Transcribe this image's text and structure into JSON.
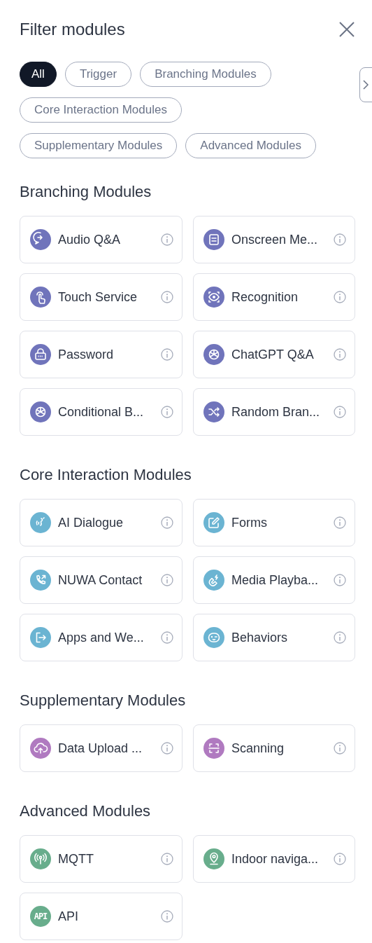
{
  "title": "Filter modules",
  "filters": [
    {
      "label": "All",
      "selected": true
    },
    {
      "label": "Trigger",
      "selected": false
    },
    {
      "label": "Branching Modules",
      "selected": false
    },
    {
      "label": "Core Interaction Modules",
      "selected": false
    },
    {
      "label": "Supplementary Modules",
      "selected": false
    },
    {
      "label": "Advanced Modules",
      "selected": false
    }
  ],
  "sections": [
    {
      "heading": "Branching Modules",
      "color": "#7074bb",
      "modules": [
        {
          "label": "Audio Q&A",
          "kind": "chat-arrow"
        },
        {
          "label": "Onscreen Me...",
          "kind": "document"
        },
        {
          "label": "Touch Service",
          "kind": "hand"
        },
        {
          "label": "Recognition",
          "kind": "eye"
        },
        {
          "label": "Password",
          "kind": "lock"
        },
        {
          "label": "ChatGPT Q&A",
          "kind": "knot"
        },
        {
          "label": "Conditional B...",
          "kind": "knot"
        },
        {
          "label": "Random Bran...",
          "kind": "shuffle"
        }
      ]
    },
    {
      "heading": "Core Interaction Modules",
      "color": "#6bb4d2",
      "modules": [
        {
          "label": "AI Dialogue",
          "kind": "voice"
        },
        {
          "label": "Forms",
          "kind": "pencil"
        },
        {
          "label": "NUWA Contact",
          "kind": "phone"
        },
        {
          "label": "Media Playba...",
          "kind": "magnet"
        },
        {
          "label": "Apps and We...",
          "kind": "exit"
        },
        {
          "label": "Behaviors",
          "kind": "face"
        }
      ]
    },
    {
      "heading": "Supplementary Modules",
      "color": "#b07ac0",
      "modules": [
        {
          "label": "Data Upload ...",
          "kind": "cloud"
        },
        {
          "label": "Scanning",
          "kind": "scan"
        }
      ]
    },
    {
      "heading": "Advanced Modules",
      "color": "#68ad8c",
      "modules": [
        {
          "label": "MQTT",
          "kind": "antenna"
        },
        {
          "label": "Indoor naviga...",
          "kind": "pin"
        },
        {
          "label": "API",
          "kind": "text",
          "icon_text": "API"
        }
      ]
    }
  ]
}
